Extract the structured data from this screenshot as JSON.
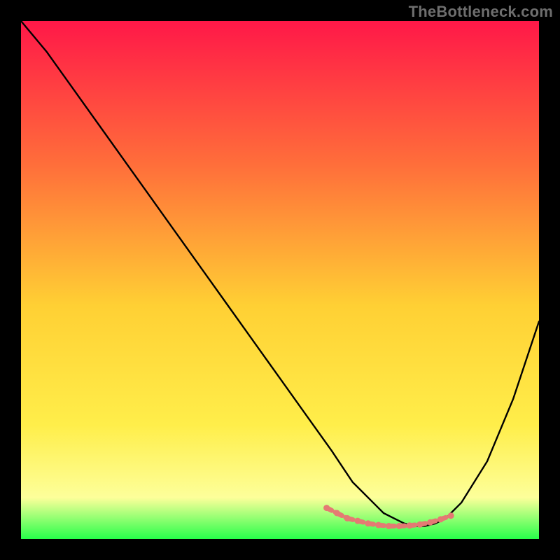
{
  "watermark": "TheBottleneck.com",
  "colors": {
    "bg": "#000000",
    "grad_top": "#ff1848",
    "grad_mid_upper": "#ff6f3a",
    "grad_mid": "#ffd034",
    "grad_mid_lower": "#ffee4a",
    "grad_lower": "#fdff9a",
    "grad_bottom": "#27ff4a",
    "curve": "#000000",
    "markers": "#e47a73"
  },
  "chart_data": {
    "type": "line",
    "title": "",
    "xlabel": "",
    "ylabel": "",
    "xlim": [
      0,
      100
    ],
    "ylim": [
      0,
      100
    ],
    "series": [
      {
        "name": "bottleneck-curve",
        "x": [
          0,
          5,
          10,
          15,
          20,
          25,
          30,
          35,
          40,
          45,
          50,
          55,
          60,
          62,
          64,
          66,
          68,
          70,
          72,
          74,
          76,
          78,
          80,
          82,
          85,
          90,
          95,
          100
        ],
        "y": [
          100,
          94,
          87,
          80,
          73,
          66,
          59,
          52,
          45,
          38,
          31,
          24,
          17,
          14,
          11,
          9,
          7,
          5,
          4,
          3,
          2.5,
          2.5,
          3,
          4,
          7,
          15,
          27,
          42
        ]
      }
    ],
    "markers": {
      "name": "highlight-segment-valley",
      "x": [
        59,
        61,
        63,
        65,
        67,
        69,
        71,
        73,
        75,
        77,
        79,
        81,
        83
      ],
      "y": [
        6,
        5,
        4,
        3.5,
        3,
        2.7,
        2.5,
        2.5,
        2.6,
        2.8,
        3.2,
        3.8,
        4.5
      ]
    }
  }
}
